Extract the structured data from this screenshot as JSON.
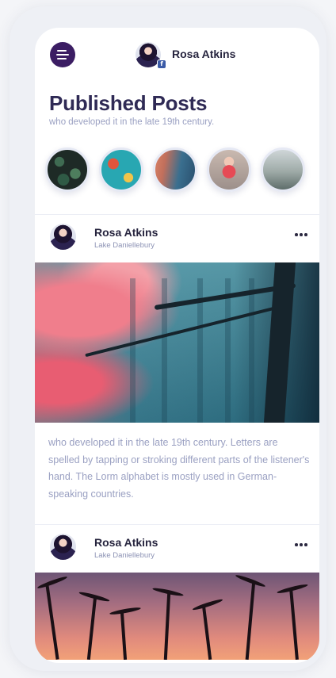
{
  "header": {
    "menu_icon": "hamburger-menu-icon",
    "user": {
      "name": "Rosa Atkins",
      "badge_icon": "facebook-icon",
      "badge_glyph": "f"
    }
  },
  "page": {
    "title": "Published Posts",
    "subtitle": "who developed it in the late 19th century."
  },
  "stories": [
    {
      "theme": "dark-green-leaves"
    },
    {
      "theme": "teal-flatlay"
    },
    {
      "theme": "autumn-forest"
    },
    {
      "theme": "girl-red-shirt"
    },
    {
      "theme": "misty-forest"
    }
  ],
  "posts": [
    {
      "author": "Rosa Atkins",
      "location": "Lake Daniellebury",
      "image": "autumn-forest-photo",
      "text": "who developed it in the late 19th century. Letters are spelled by tapping or stroking different parts of the listener's hand. The Lorm alphabet is mostly used in German-speaking countries."
    },
    {
      "author": "Rosa Atkins",
      "location": "Lake Daniellebury",
      "image": "palm-sunset-photo"
    }
  ],
  "colors": {
    "accent": "#3b1d63",
    "title": "#2f2a55",
    "muted": "#9aa0c2",
    "facebook": "#3b5ba7"
  }
}
